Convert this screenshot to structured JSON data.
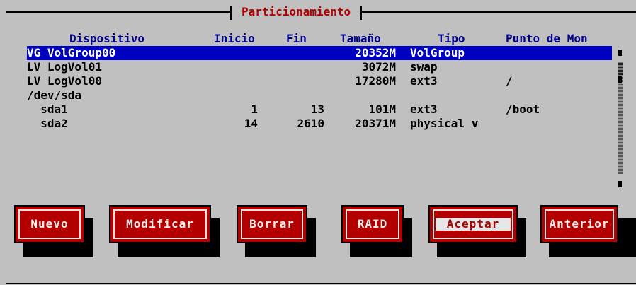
{
  "window": {
    "title": "Particionamiento"
  },
  "table": {
    "headers": [
      "Dispositivo",
      "Inicio",
      "Fin",
      "Tamaño",
      "Tipo",
      "Punto de Mon"
    ],
    "rows": [
      {
        "device": "VG VolGroup00",
        "start": "",
        "end": "",
        "size": "20352M",
        "type": "VolGroup",
        "mount": "",
        "selected": true
      },
      {
        "device": "LV LogVol01",
        "start": "",
        "end": "",
        "size": "3072M",
        "type": "swap",
        "mount": ""
      },
      {
        "device": "LV LogVol00",
        "start": "",
        "end": "",
        "size": "17280M",
        "type": "ext3",
        "mount": "/"
      },
      {
        "device": "/dev/sda",
        "start": "",
        "end": "",
        "size": "",
        "type": "",
        "mount": ""
      },
      {
        "device": "  sda1",
        "start": "1",
        "end": "13",
        "size": "101M",
        "type": "ext3",
        "mount": "/boot"
      },
      {
        "device": "  sda2",
        "start": "14",
        "end": "2610",
        "size": "20371M",
        "type": "physical v",
        "mount": ""
      }
    ]
  },
  "buttons": {
    "new": "Nuevo",
    "modify": "Modificar",
    "delete": "Borrar",
    "raid": "RAID",
    "accept": "Aceptar",
    "previous": "Anterior"
  },
  "colors": {
    "background": "#c0c0c0",
    "selection": "#0000c0",
    "button": "#b20000",
    "header": "#00008b",
    "title": "#b00000"
  }
}
